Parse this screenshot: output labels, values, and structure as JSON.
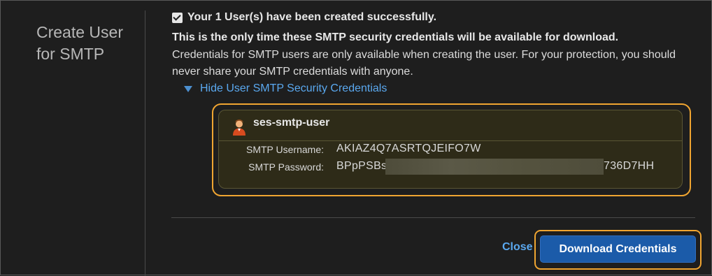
{
  "sidebar": {
    "title_line1": "Create User",
    "title_line2": "for SMTP"
  },
  "message": {
    "success": "Your 1 User(s) have been created successfully.",
    "warning": "This is the only time these SMTP security credentials will be available for download.",
    "info": "Credentials for SMTP users are only available when creating the user. For your protection, you should never share your SMTP credentials with anyone."
  },
  "toggle": {
    "label": "Hide User SMTP Security Credentials"
  },
  "credentials": {
    "user_name": "ses-smtp-user",
    "username_label": "SMTP Username:",
    "username_value": "AKIAZ4Q7ASRTQJEIFO7W",
    "password_label": "SMTP Password:",
    "password_prefix": "BPpPSBs",
    "password_suffix": "736D7HH"
  },
  "footer": {
    "close_label": "Close",
    "download_label": "Download Credentials"
  },
  "colors": {
    "link": "#5aa8ef",
    "focus_ring": "#f0a531",
    "button_primary": "#1b5ba9",
    "credential_box": "#2e2b18"
  },
  "icons": {
    "success_check": "checkbox-checked-icon",
    "toggle": "triangle-down-icon",
    "user": "user-icon"
  }
}
